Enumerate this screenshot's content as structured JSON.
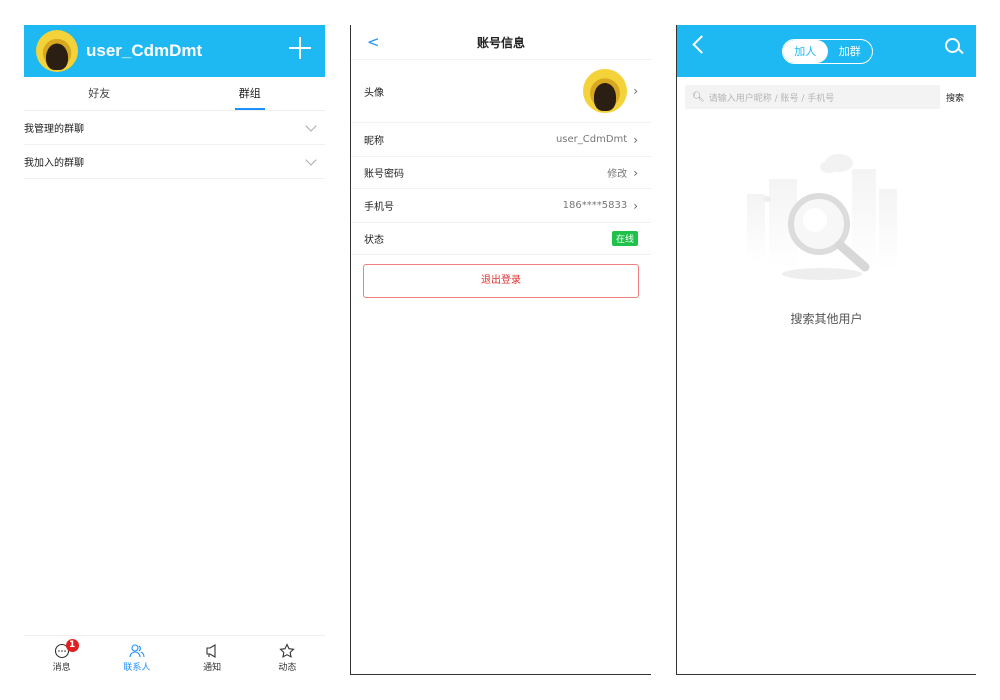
{
  "contacts": {
    "username": "user_CdmDmt",
    "tabs": [
      "好友",
      "群组"
    ],
    "groups": [
      {
        "label": "我管理的群聊"
      },
      {
        "label": "我加入的群聊"
      }
    ],
    "nav": [
      {
        "label": "消息",
        "icon": "chat-icon",
        "badge": "1"
      },
      {
        "label": "联系人",
        "icon": "contacts-icon"
      },
      {
        "label": "通知",
        "icon": "megaphone-icon"
      },
      {
        "label": "动态",
        "icon": "star-icon"
      }
    ],
    "colors": {
      "header": "#1eb8f3",
      "accent": "#1e90ff",
      "badge": "#e02020"
    }
  },
  "account": {
    "back": "<",
    "title": "账号信息",
    "avatar_label": "头像",
    "nickname_label": "昵称",
    "nickname_value": "user_CdmDmt",
    "password_label": "账号密码",
    "password_value": "修改",
    "phone_label": "手机号",
    "phone_value": "186****5833",
    "status_label": "状态",
    "status_value": "在线",
    "logout_label": "退出登录",
    "colors": {
      "online": "#1ec24a",
      "logout": "#e03030"
    }
  },
  "add": {
    "segments": [
      "加人",
      "加群"
    ],
    "search_placeholder": "请输入用户昵称 / 账号 / 手机号",
    "search_button": "搜索",
    "empty_text": "搜索其他用户"
  }
}
